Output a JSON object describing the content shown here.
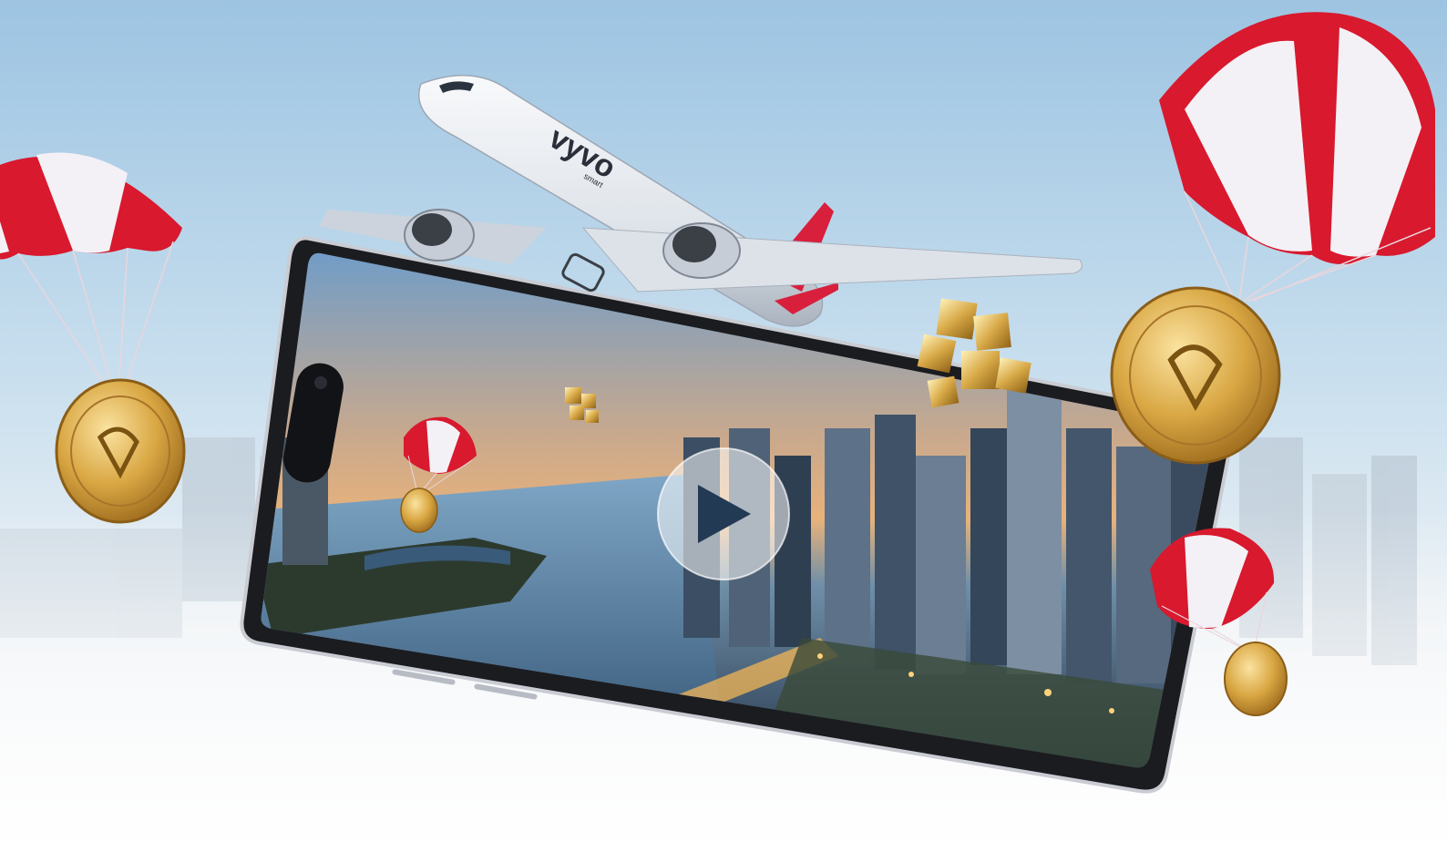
{
  "airline_logo": {
    "text": "vyvo",
    "subtext": "smart"
  },
  "play_button": {
    "icon": "play-icon",
    "interactable": true
  },
  "colors": {
    "sky_top": "#9fc6e3",
    "sky_bottom": "#f2f5f7",
    "parachute_red": "#d8192e",
    "parachute_white": "#f4f1f6",
    "coin_gold": "#d9a743",
    "plane_body": "#e6eaf0",
    "plane_tail": "#d81f3c"
  }
}
